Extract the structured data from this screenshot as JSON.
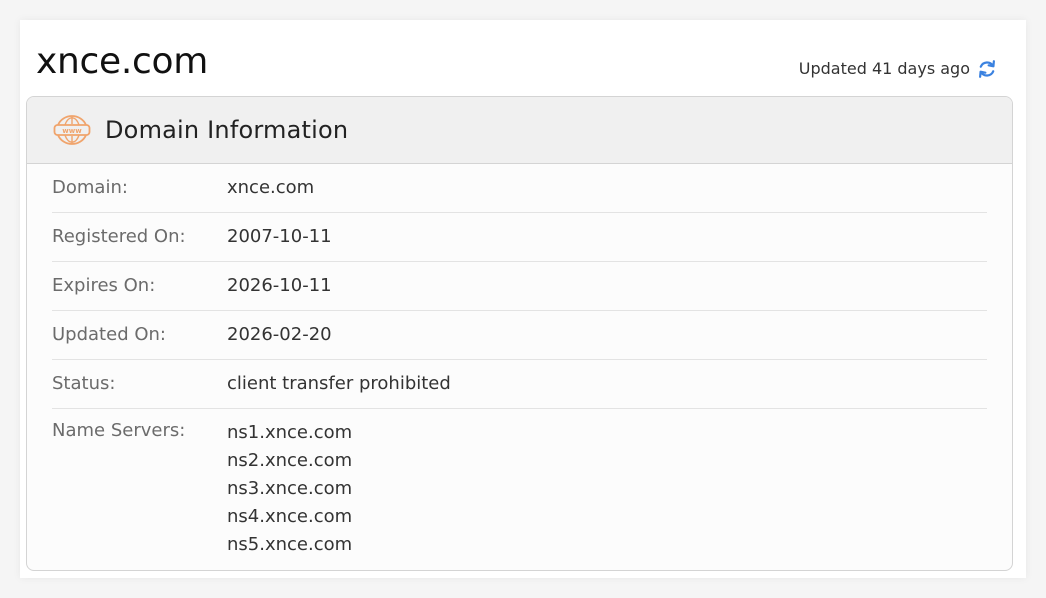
{
  "page": {
    "domain_title": "xnce.com",
    "updated_text": "Updated 41 days ago"
  },
  "section": {
    "title": "Domain Information",
    "icon": "www-globe-icon"
  },
  "rows": [
    {
      "label": "Domain:",
      "value": "xnce.com"
    },
    {
      "label": "Registered On:",
      "value": "2007-10-11"
    },
    {
      "label": "Expires On:",
      "value": "2026-10-11"
    },
    {
      "label": "Updated On:",
      "value": "2026-02-20"
    },
    {
      "label": "Status:",
      "value": "client transfer prohibited"
    }
  ],
  "name_servers": {
    "label": "Name Servers:",
    "values": [
      "ns1.xnce.com",
      "ns2.xnce.com",
      "ns3.xnce.com",
      "ns4.xnce.com",
      "ns5.xnce.com"
    ]
  },
  "colors": {
    "accent_orange": "#f0a46c",
    "refresh_blue": "#3b82e0",
    "header_bg": "#f0f0f0"
  }
}
